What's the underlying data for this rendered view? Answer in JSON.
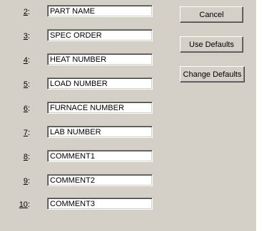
{
  "rows": [
    {
      "number": "2",
      "suffix": ":",
      "value": "PART NAME"
    },
    {
      "number": "3",
      "suffix": ":",
      "value": "SPEC ORDER"
    },
    {
      "number": "4",
      "suffix": ":",
      "value": "HEAT NUMBER"
    },
    {
      "number": "5",
      "suffix": ":",
      "value": "LOAD NUMBER"
    },
    {
      "number": "6",
      "suffix": ":",
      "value": "FURNACE NUMBER"
    },
    {
      "number": "7",
      "suffix": ":",
      "value": "LAB NUMBER"
    },
    {
      "number": "8",
      "suffix": ":",
      "value": "COMMENT1"
    },
    {
      "number": "9",
      "suffix": ":",
      "value": "COMMENT2"
    },
    {
      "number": "10",
      "suffix": ":",
      "value": "COMMENT3"
    }
  ],
  "buttons": {
    "cancel": "Cancel",
    "use_defaults": "Use Defaults",
    "change_defaults": "Change Defaults"
  }
}
